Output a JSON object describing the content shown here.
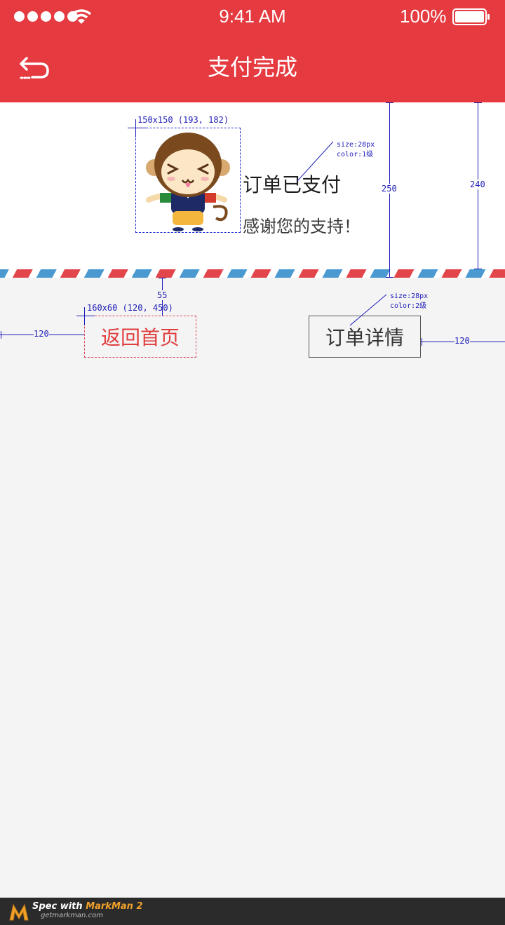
{
  "status_bar": {
    "time": "9:41 AM",
    "battery": "100%"
  },
  "header": {
    "title": "支付完成"
  },
  "order": {
    "status": "订单已支付",
    "thanks": "感谢您的支持！"
  },
  "buttons": {
    "home": "返回首页",
    "detail": "订单详情"
  },
  "annotations": {
    "avatar_spec": "150x150 (193, 182)",
    "title_font": "size:28px",
    "title_color": "color:1级",
    "height_250": "250",
    "height_240": "240",
    "gap_55": "55",
    "home_spec": "160x60 (120, 450)",
    "detail_font": "size:28px",
    "detail_color": "color:2级",
    "margin_left": "120",
    "margin_right": "120"
  },
  "footer": {
    "brand_prefix": "Spec with",
    "brand": "MarkMan 2",
    "url": "getmarkman.com"
  },
  "colors": {
    "primary": "#e53a40",
    "background": "#f4f4f4",
    "annotation": "#1d1db8"
  }
}
